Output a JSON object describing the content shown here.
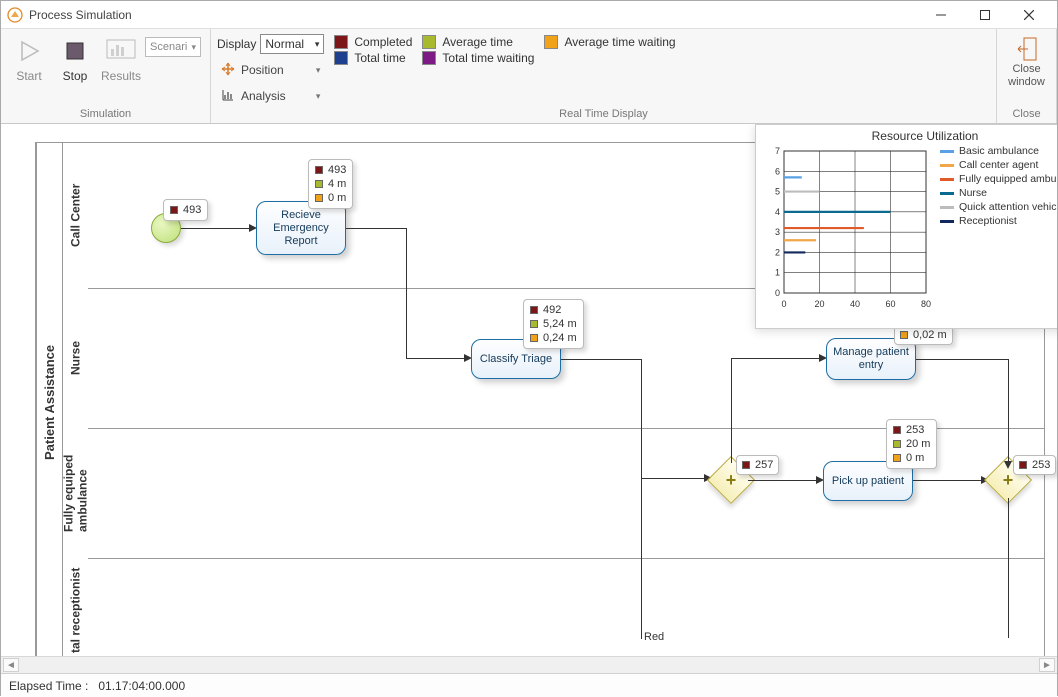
{
  "window": {
    "title": "Process Simulation"
  },
  "ribbon": {
    "simulation": {
      "label": "Simulation",
      "start": "Start",
      "stop": "Stop",
      "results": "Results",
      "scenario": "Scenari"
    },
    "realtime": {
      "label": "Real Time Display",
      "display_label": "Display",
      "display_value": "Normal",
      "position": "Position",
      "analysis": "Analysis",
      "completed": "Completed",
      "avg_time": "Average time",
      "avg_wait": "Average time waiting",
      "total_time": "Total time",
      "total_wait": "Total time waiting"
    },
    "close": {
      "label": "Close",
      "btn_line1": "Close",
      "btn_line2": "window"
    }
  },
  "pool": {
    "title": "Patient Assistance",
    "lanes": {
      "callcenter": "Call Center",
      "nurse": "Nurse",
      "ambulance": "Fully equiped\nambulance",
      "receptionist": "tal receptionist"
    }
  },
  "nodes": {
    "start_badge": "493",
    "recieve": {
      "label": "Recieve Emergency Report",
      "badge": {
        "completed": "493",
        "avg": "4 m",
        "wait": "0 m"
      }
    },
    "classify": {
      "label": "Classify Triage",
      "badge": {
        "completed": "492",
        "avg": "5,24 m",
        "wait": "0,24 m"
      }
    },
    "manage": {
      "label": "Manage patient entry",
      "badge": {
        "wait": "0,02 m"
      }
    },
    "gateway1": {
      "count": "257"
    },
    "pickup": {
      "label": "Pick up patient",
      "badge": {
        "completed": "253",
        "avg": "20 m",
        "wait": "0 m"
      }
    },
    "gateway2": {
      "count": "253"
    },
    "red_label": "Red"
  },
  "util": {
    "title": "Resource Utilization",
    "legend": {
      "basic": "Basic ambulance",
      "agent": "Call center agent",
      "full": "Fully equipped ambulance",
      "nurse": "Nurse",
      "quick": "Quick attention vehicle",
      "recep": "Receptionist"
    }
  },
  "chart_data": {
    "type": "bar",
    "title": "Resource Utilization",
    "xlabel": "",
    "ylabel": "",
    "xlim": [
      0,
      80
    ],
    "ylim": [
      0,
      7
    ],
    "x_ticks": [
      0,
      20,
      40,
      60,
      80
    ],
    "y_ticks": [
      0,
      1,
      2,
      3,
      4,
      5,
      6,
      7
    ],
    "series": [
      {
        "name": "Basic ambulance",
        "color": "#5aa0e6",
        "y": 5.7,
        "length": 10
      },
      {
        "name": "Call center agent",
        "color": "#f0a74a",
        "y": 2.6,
        "length": 18
      },
      {
        "name": "Fully equipped ambulance",
        "color": "#e05a2a",
        "y": 3.2,
        "length": 45
      },
      {
        "name": "Nurse",
        "color": "#0a6a8f",
        "y": 4.0,
        "length": 60
      },
      {
        "name": "Quick attention vehicle",
        "color": "#bcbcbc",
        "y": 5.0,
        "length": 20
      },
      {
        "name": "Receptionist",
        "color": "#12295e",
        "y": 2.0,
        "length": 12
      }
    ]
  },
  "status": {
    "label": "Elapsed Time :",
    "value": "01.17:04:00.000"
  }
}
